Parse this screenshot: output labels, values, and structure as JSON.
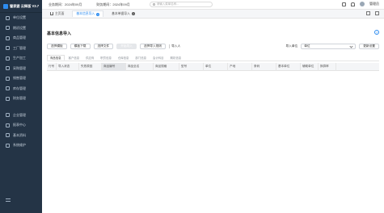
{
  "app": {
    "logo_text": "管家婆 云辉版 V3.7"
  },
  "sidebar": {
    "items": [
      {
        "label": "单位设置"
      },
      {
        "label": "期初设置"
      },
      {
        "label": "商品管理"
      },
      {
        "label": "工厂管理"
      },
      {
        "label": "生产加工"
      },
      {
        "label": "采购管理"
      },
      {
        "label": "销售管理"
      },
      {
        "label": "库存管理"
      },
      {
        "label": "财务管理"
      }
    ],
    "items2": [
      {
        "label": "企业管理"
      },
      {
        "label": "报表中心"
      },
      {
        "label": "基本资料"
      },
      {
        "label": "系统维护"
      }
    ]
  },
  "topbar": {
    "period1": "业务期间：2024年09月",
    "period2": "财务期间：2024年09月",
    "search_placeholder": "请输入菜单名称...",
    "user": "管理员"
  },
  "tabs": [
    {
      "label": "主页面"
    },
    {
      "label": "基本信息导入"
    },
    {
      "label": "基本单据导入"
    }
  ],
  "page": {
    "title": "基本信息导入",
    "help": "?",
    "toolbar": {
      "b1": "选择模板",
      "b2": "模板下载",
      "b3": "选择文件",
      "b4": "开始导入",
      "b5": "选择导入规则",
      "import_label": "导入人",
      "unit_label": "导入单位",
      "unit_value": "单位",
      "b6": "更新设置"
    },
    "subtabs": [
      "商品信息",
      "客户信息",
      "供应商",
      "职员信息",
      "仓库信息",
      "部门信息",
      "会计科目",
      "期初信息"
    ],
    "columns": [
      "行号",
      "导入状态",
      "失败原因",
      "商品编号",
      "商品全名",
      "商品规格",
      "型号",
      "单位",
      "产地",
      "条码",
      "基本单位",
      "辅助单位",
      "换算率"
    ]
  }
}
